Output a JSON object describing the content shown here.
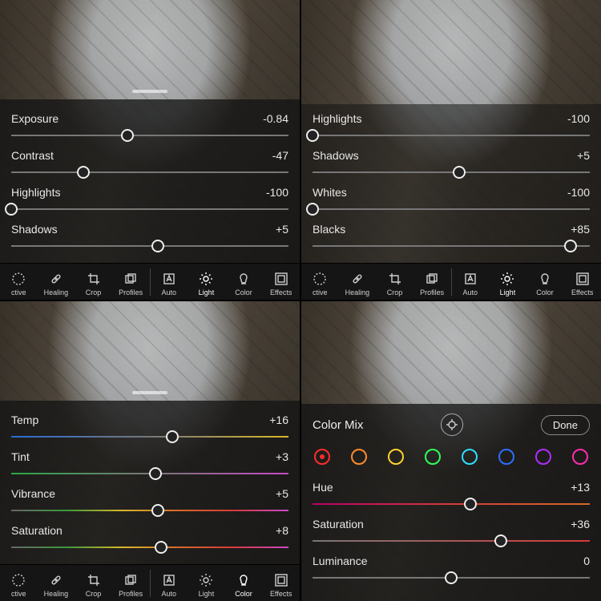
{
  "panels": {
    "p1": {
      "sliders": [
        {
          "label": "Exposure",
          "value": "-0.84",
          "pos": 42
        },
        {
          "label": "Contrast",
          "value": "-47",
          "pos": 26
        },
        {
          "label": "Highlights",
          "value": "-100",
          "pos": 0
        },
        {
          "label": "Shadows",
          "value": "+5",
          "pos": 53
        }
      ],
      "selected": "Light"
    },
    "p2": {
      "sliders": [
        {
          "label": "Highlights",
          "value": "-100",
          "pos": 0
        },
        {
          "label": "Shadows",
          "value": "+5",
          "pos": 53
        },
        {
          "label": "Whites",
          "value": "-100",
          "pos": 0
        },
        {
          "label": "Blacks",
          "value": "+85",
          "pos": 93
        }
      ],
      "selected": "Light"
    },
    "p3": {
      "sliders": [
        {
          "label": "Temp",
          "value": "+16",
          "pos": 58,
          "grad": "grad-temp"
        },
        {
          "label": "Tint",
          "value": "+3",
          "pos": 52,
          "grad": "grad-tint"
        },
        {
          "label": "Vibrance",
          "value": "+5",
          "pos": 53,
          "grad": "grad-vib"
        },
        {
          "label": "Saturation",
          "value": "+8",
          "pos": 54,
          "grad": "grad-sat"
        }
      ],
      "selected": "Color"
    },
    "p4": {
      "header": {
        "title": "Color Mix",
        "done": "Done"
      },
      "swatches": [
        "#ff2d2d",
        "#ff8a2d",
        "#ffd22d",
        "#2dff5a",
        "#2ddfff",
        "#2d6dff",
        "#b02dff",
        "#ff2db0"
      ],
      "active_swatch": 0,
      "sliders": [
        {
          "label": "Hue",
          "value": "+13",
          "pos": 57,
          "grad": "grad-hue"
        },
        {
          "label": "Saturation",
          "value": "+36",
          "pos": 68,
          "grad": "grad-sat2"
        },
        {
          "label": "Luminance",
          "value": "0",
          "pos": 50
        }
      ]
    }
  },
  "toolbar": {
    "left": [
      {
        "key": "ctive",
        "label": "ctive",
        "icon": "selective"
      },
      {
        "key": "healing",
        "label": "Healing",
        "icon": "healing"
      },
      {
        "key": "crop",
        "label": "Crop",
        "icon": "crop"
      },
      {
        "key": "profiles",
        "label": "Profiles",
        "icon": "profiles"
      }
    ],
    "right": [
      {
        "key": "auto",
        "label": "Auto",
        "icon": "auto"
      },
      {
        "key": "light",
        "label": "Light",
        "icon": "light"
      },
      {
        "key": "color",
        "label": "Color",
        "icon": "color"
      },
      {
        "key": "effects",
        "label": "Effects",
        "icon": "effects"
      }
    ]
  }
}
